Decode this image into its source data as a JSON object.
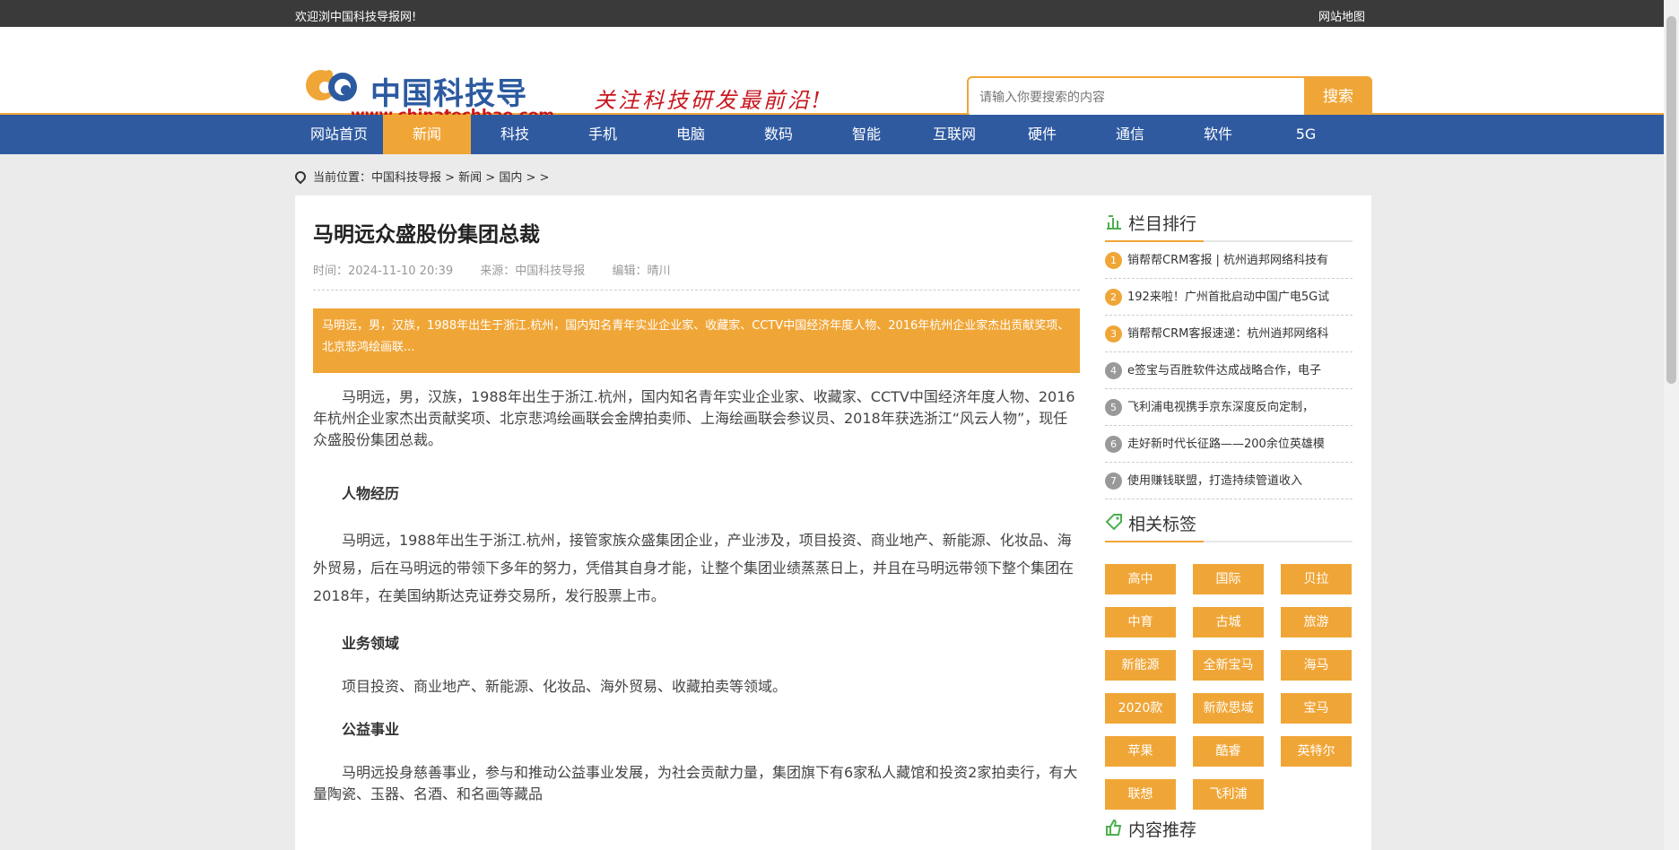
{
  "topbar": {
    "welcome": "欢迎浏中国科技导报网!",
    "sitemap": "网站地图"
  },
  "header": {
    "logo_cn": "中国科技导报",
    "logo_en": "www.chinatechbao.com",
    "slogan": "关注科技研发最前沿!",
    "search_placeholder": "请输入你要搜索的内容",
    "search_button": "搜索"
  },
  "nav": [
    "网站首页",
    "新闻",
    "科技",
    "手机",
    "电脑",
    "数码",
    "智能",
    "互联网",
    "硬件",
    "通信",
    "软件",
    "5G"
  ],
  "breadcrumb": {
    "label": "当前位置：",
    "path": "中国科技导报 > 新闻 > 国内 > >"
  },
  "article": {
    "title": "马明远众盛股份集团总裁",
    "time": "时间：2024-11-10 20:39",
    "source": "来源：中国科技导报",
    "editor": "编辑：晴川",
    "summary": "马明远，男，汉族，1988年出生于浙江.杭州，国内知名青年实业企业家、收藏家、CCTV中国经济年度人物、2016年杭州企业家杰出贡献奖项、北京悲鸿绘画联...",
    "p1": "马明远，男，汉族，1988年出生于浙江.杭州，国内知名青年实业企业家、收藏家、CCTV中国经济年度人物、2016年杭州企业家杰出贡献奖项、北京悲鸿绘画联会金牌拍卖师、上海绘画联会参议员、2018年获选浙江“风云人物”，现任众盛股份集团总裁。",
    "h1": "人物经历",
    "p2": "马明远，1988年出生于浙江.杭州，接管家族众盛集团企业，产业涉及，项目投资、商业地产、新能源、化妆品、海外贸易，后在马明远的带领下多年的努力，凭借其自身才能，让整个集团业绩蒸蒸日上，并且在马明远带领下整个集团在2018年，在美国纳斯达克证券交易所，发行股票上市。",
    "h2": "业务领域",
    "p3": "项目投资、商业地产、新能源、化妆品、海外贸易、收藏拍卖等领域。",
    "h3": "公益事业",
    "p4": "马明远投身慈善事业，参与和推动公益事业发展，为社会贡献力量，集团旗下有6家私人藏馆和投资2家拍卖行，有大量陶瓷、玉器、名酒、和名画等藏品"
  },
  "sidebar": {
    "rank_title": "栏目排行",
    "rank": [
      {
        "n": "1",
        "text": "销帮帮CRM客报 | 杭州逍邦网络科技有"
      },
      {
        "n": "2",
        "text": "192来啦！广州首批启动中国广电5G试"
      },
      {
        "n": "3",
        "text": "销帮帮CRM客报速递：杭州逍邦网络科"
      },
      {
        "n": "4",
        "text": "e签宝与百胜软件达成战略合作，电子"
      },
      {
        "n": "5",
        "text": "飞利浦电视携手京东深度反向定制，"
      },
      {
        "n": "6",
        "text": "走好新时代长征路——200余位英雄模"
      },
      {
        "n": "7",
        "text": "使用赚钱联盟，打造持续管道收入"
      }
    ],
    "tags_title": "相关标签",
    "tags": [
      "高中",
      "国际",
      "贝拉",
      "中育",
      "古城",
      "旅游",
      "新能源",
      "全新宝马",
      "海马",
      "2020款",
      "新款思域",
      "宝马",
      "苹果",
      "酷睿",
      "英特尔",
      "联想",
      "飞利浦"
    ],
    "recommend_title": "内容推荐"
  },
  "colors": {
    "accent": "#f0a637",
    "nav": "#2f5aa0",
    "topbar": "#3a3a3a"
  }
}
